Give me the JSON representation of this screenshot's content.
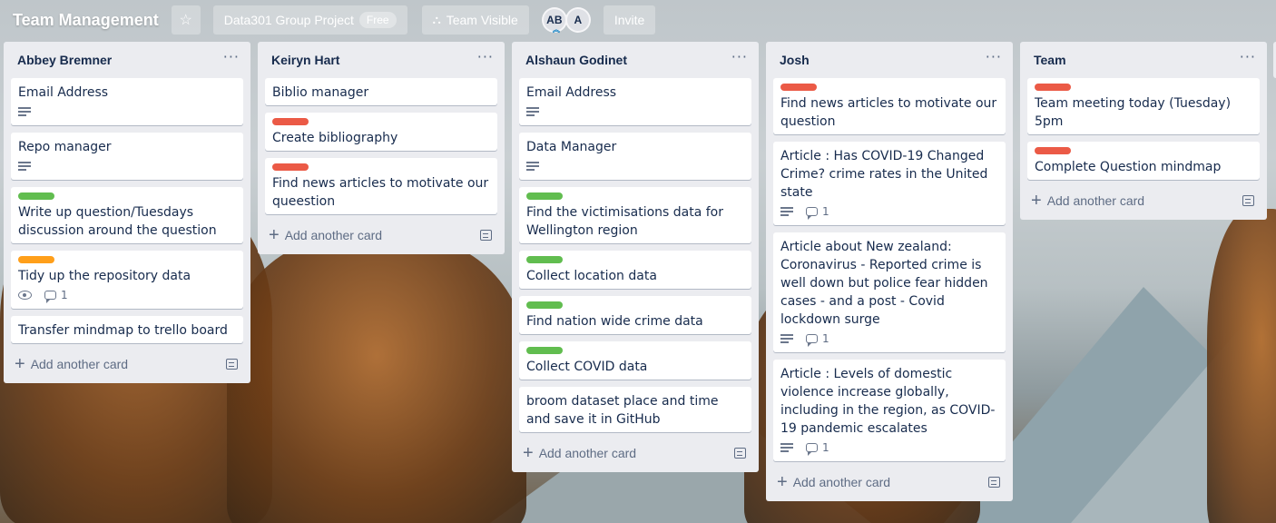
{
  "header": {
    "board_title": "Team Management",
    "workspace_name": "Data301 Group Project",
    "workspace_badge": "Free",
    "visibility_label": "Team Visible",
    "members": [
      {
        "initials": "AB"
      },
      {
        "initials": "A"
      }
    ],
    "invite_label": "Invite"
  },
  "lists": [
    {
      "title": "Abbey Bremner",
      "add_card_label": "Add another card",
      "cards": [
        {
          "title": "Email Address",
          "label": null,
          "description": true,
          "watch": false,
          "comments": null
        },
        {
          "title": "Repo manager",
          "label": null,
          "description": true,
          "watch": false,
          "comments": null
        },
        {
          "title": "Write up question/Tuesdays discussion around the question",
          "label": "#61bd4f",
          "description": false,
          "watch": false,
          "comments": null
        },
        {
          "title": "Tidy up the repository data",
          "label": "#ff9f1a",
          "description": false,
          "watch": true,
          "comments": "1"
        },
        {
          "title": "Transfer mindmap to trello board",
          "label": null,
          "description": false,
          "watch": false,
          "comments": null
        }
      ]
    },
    {
      "title": "Keiryn Hart",
      "add_card_label": "Add another card",
      "cards": [
        {
          "title": "Biblio manager",
          "label": null,
          "description": false,
          "watch": false,
          "comments": null
        },
        {
          "title": "Create bibliography",
          "label": "#eb5a46",
          "description": false,
          "watch": false,
          "comments": null
        },
        {
          "title": "Find news articles to motivate our queestion",
          "label": "#eb5a46",
          "description": false,
          "watch": false,
          "comments": null
        }
      ]
    },
    {
      "title": "Alshaun Godinet",
      "add_card_label": "Add another card",
      "cards": [
        {
          "title": "Email Address",
          "label": null,
          "description": true,
          "watch": false,
          "comments": null
        },
        {
          "title": "Data Manager",
          "label": null,
          "description": true,
          "watch": false,
          "comments": null
        },
        {
          "title": "Find the victimisations data for Wellington region",
          "label": "#61bd4f",
          "description": false,
          "watch": false,
          "comments": null
        },
        {
          "title": "Collect location data",
          "label": "#61bd4f",
          "description": false,
          "watch": false,
          "comments": null
        },
        {
          "title": "Find nation wide crime data",
          "label": "#61bd4f",
          "description": false,
          "watch": false,
          "comments": null
        },
        {
          "title": "Collect COVID data",
          "label": "#61bd4f",
          "description": false,
          "watch": false,
          "comments": null
        },
        {
          "title": "broom dataset place and time and save it in GitHub",
          "label": null,
          "description": false,
          "watch": false,
          "comments": null
        }
      ]
    },
    {
      "title": "Josh",
      "add_card_label": "Add another card",
      "cards": [
        {
          "title": "Find news articles to motivate our question",
          "label": "#eb5a46",
          "description": false,
          "watch": false,
          "comments": null
        },
        {
          "title": "Article : Has COVID-19 Changed Crime? crime rates in the United state",
          "label": null,
          "description": true,
          "watch": false,
          "comments": "1"
        },
        {
          "title": "Article about New zealand: Coronavirus - Reported crime is well down but police fear hidden cases - and a post - Covid lockdown surge",
          "label": null,
          "description": true,
          "watch": false,
          "comments": "1"
        },
        {
          "title": "Article : Levels of domestic violence increase globally, including in the region, as COVID-19 pandemic escalates",
          "label": null,
          "description": true,
          "watch": false,
          "comments": "1"
        }
      ]
    },
    {
      "title": "Team",
      "add_card_label": "Add another card",
      "cards": [
        {
          "title": "Team meeting today (Tuesday) 5pm",
          "label": "#eb5a46",
          "description": false,
          "watch": false,
          "comments": null
        },
        {
          "title": "Complete Question mindmap",
          "label": "#eb5a46",
          "description": false,
          "watch": false,
          "comments": null
        }
      ]
    }
  ]
}
